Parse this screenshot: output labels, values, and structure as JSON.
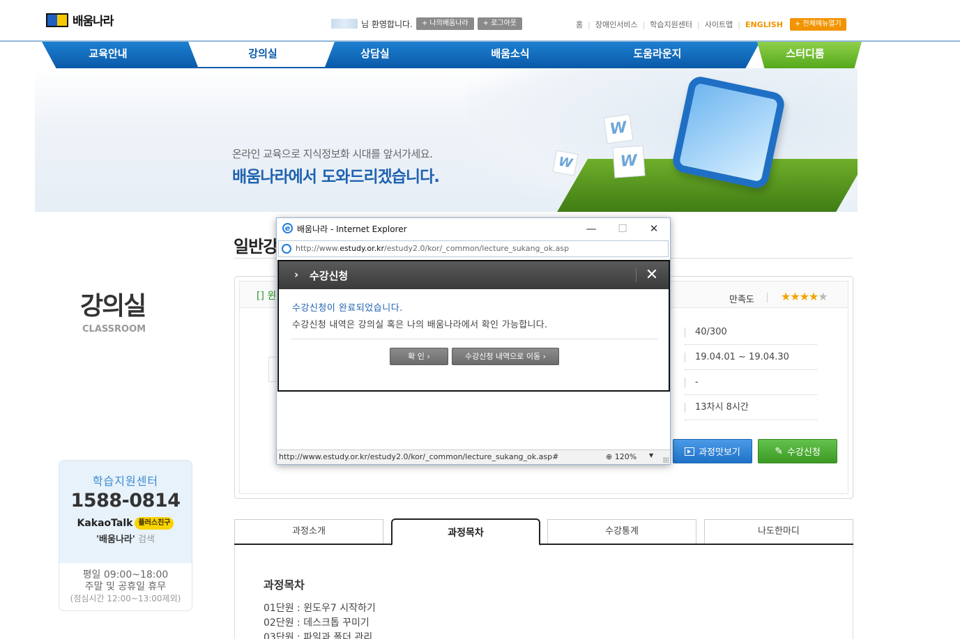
{
  "header": {
    "logo_text": "배움나라",
    "welcome_suffix": "님 환영합니다.",
    "my_button": "+ 나의배움나라",
    "logout_button": "+ 로그아웃",
    "util_links": [
      "홈",
      "장애인서비스",
      "학습지원센터",
      "사이트맵"
    ],
    "english_link": "ENGLISH",
    "all_menu_button": "+ 전체메뉴열기"
  },
  "gnb": {
    "items": [
      "교육안내",
      "강의실",
      "상담실",
      "배움소식",
      "도움라운지",
      "스터디룸"
    ],
    "active": "강의실"
  },
  "hero": {
    "line1": "온라인 교육으로 지식정보화 시대를 앞서가세요.",
    "line2": "배움나라에서 도와드리겠습니다.",
    "cube_glyph": "W"
  },
  "sidebar": {
    "title": "강의실",
    "subtitle": "CLASSROOM",
    "support": {
      "title": "학습지원센터",
      "phone": "1588-0814",
      "kakao_label": "KakaoTalk",
      "kakao_badge": "플러스친구",
      "kakao_id": "'배움나라'",
      "kakao_search": "검색",
      "hours1": "평일 09:00~18:00",
      "hours2": "주말 및 공휴일 휴무",
      "hours_note": "(점심시간 12:00~13:00제외)"
    }
  },
  "main": {
    "title_partial": "일반강",
    "course_name_partial": "[] 윈",
    "satisfaction_label": "만족도",
    "stars": {
      "filled": 4,
      "total": 5
    },
    "info_rows": [
      "40/300",
      "19.04.01 ~ 19.04.30",
      "-",
      "13차시 8시간"
    ],
    "preview_button": "과정맛보기",
    "apply_button": "수강신청",
    "tabs": [
      "과정소개",
      "과정목차",
      "수강통계",
      "나도한마디"
    ],
    "active_tab": "과정목차",
    "toc_title": "과정목차",
    "toc_items": [
      "01단원 : 윈도우7 시작하기",
      "02단원 : 데스크톱 꾸미기",
      "03단원 : 파일과 폴더 관리"
    ]
  },
  "popup": {
    "window_title": "배움나라 - Internet Explorer",
    "url_prefix": "http://www.",
    "url_domain": "estudy.or.kr",
    "url_path": "/estudy2.0/kor/_common/lecture_sukang_ok.asp",
    "dialog_title": "수강신청",
    "message1": "수강신청이 완료되었습니다.",
    "message2": "수강신청 내역은 강의실 혹은 나의 배움나라에서 확인 가능합니다.",
    "ok_button": "확  인 ›",
    "history_button": "수강신청 내역으로 이동 ›",
    "status_url": "http://www.estudy.or.kr/estudy2.0/kor/_common/lecture_sukang_ok.asp#",
    "zoom": "120%"
  },
  "colors": {
    "brand_blue": "#0a5aa8",
    "study_green": "#55a81c",
    "accent_orange": "#f29400",
    "message_blue": "#1f62b0"
  }
}
